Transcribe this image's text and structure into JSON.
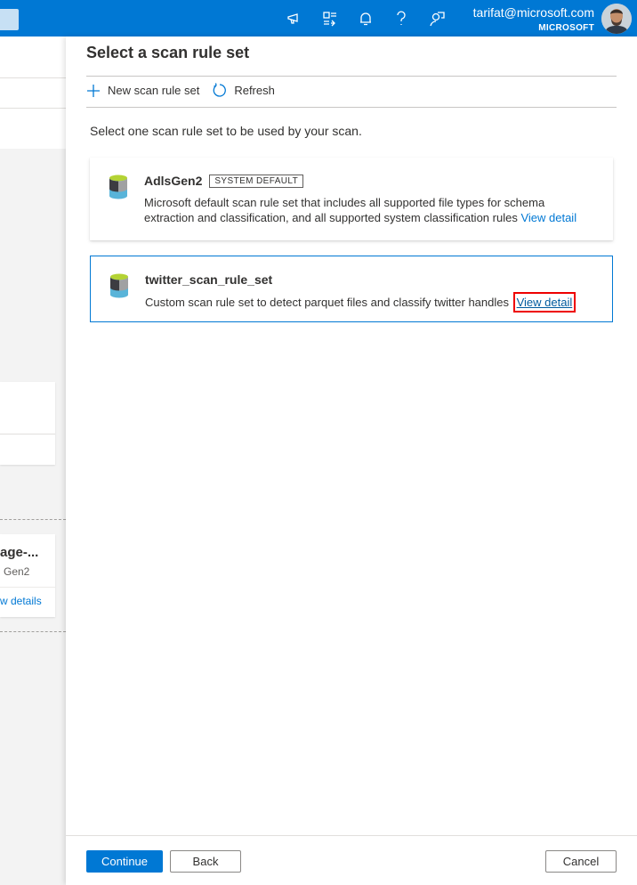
{
  "header": {
    "user_email": "tarifat@microsoft.com",
    "user_org": "MICROSOFT",
    "icons": [
      "announcement-icon",
      "directory-switch-icon",
      "notifications-icon",
      "help-icon",
      "feedback-icon"
    ]
  },
  "background": {
    "card_title": "age-...",
    "card_subtitle": "Gen2",
    "card_link": "w details"
  },
  "panel": {
    "title": "Select a scan rule set",
    "toolbar": {
      "new_label": "New scan rule set",
      "refresh_label": "Refresh"
    },
    "description": "Select one scan rule set to be used by your scan.",
    "rule_sets": [
      {
        "name": "AdlsGen2",
        "badge": "SYSTEM DEFAULT",
        "description": "Microsoft default scan rule set that includes all supported file types for schema extraction and classification, and all supported system classification rules",
        "link": "View detail"
      },
      {
        "name": "twitter_scan_rule_set",
        "description": "Custom scan rule set to detect parquet files and classify twitter handles",
        "link": "View detail"
      }
    ]
  },
  "footer": {
    "continue_label": "Continue",
    "back_label": "Back",
    "cancel_label": "Cancel"
  },
  "colors": {
    "accent": "#0078d4",
    "highlight": "#e00000"
  }
}
